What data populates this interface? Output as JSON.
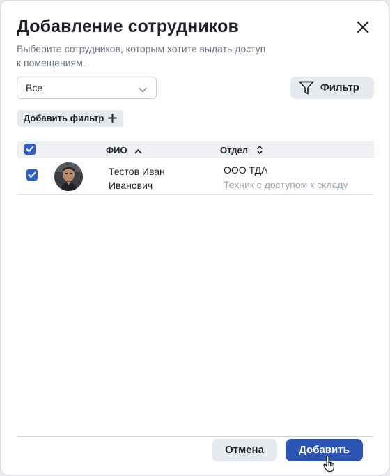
{
  "dialog": {
    "title": "Добавление сотрудников",
    "subtitle": "Выберите сотрудников, которым хотите выдать доступ к помещениям.",
    "close_icon": "close-icon"
  },
  "controls": {
    "select_value": "Все",
    "filter_label": "Фильтр",
    "add_filter_label": "Добавить фильтр"
  },
  "table": {
    "columns": [
      {
        "label": "ФИО",
        "sort": "ascending"
      },
      {
        "label": "Отдел",
        "sort": "none"
      }
    ],
    "header_checkbox_checked": true,
    "rows": [
      {
        "checked": true,
        "name": "Тестов Иван Иванович",
        "department": "ООО ТДА",
        "role": "Техник с доступом к складу",
        "avatar": "avatar-photo"
      }
    ]
  },
  "footer": {
    "cancel_label": "Отмена",
    "add_label": "Добавить"
  },
  "colors": {
    "accent": "#2c55b4",
    "checkbox": "#2c5ec5",
    "secondary_button": "#e6e9ee",
    "muted_text": "#9aa1ab"
  }
}
